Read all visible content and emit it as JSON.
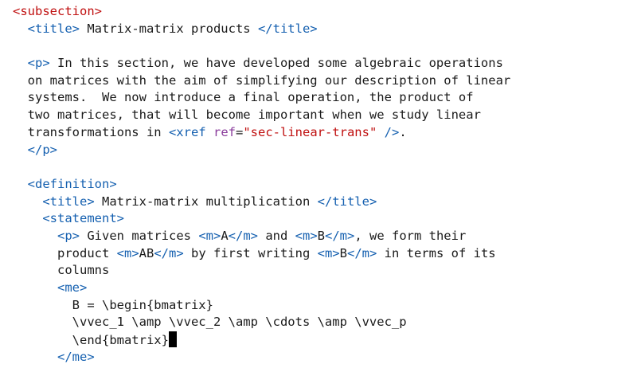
{
  "editor": {
    "lines": [
      [
        {
          "t": "<subsection>",
          "c": "tag-root"
        }
      ],
      [
        {
          "t": "  "
        },
        {
          "t": "<title>",
          "c": "tag"
        },
        {
          "t": " Matrix-matrix products "
        },
        {
          "t": "</title>",
          "c": "tag"
        }
      ],
      [],
      [
        {
          "t": "  "
        },
        {
          "t": "<p>",
          "c": "tag"
        },
        {
          "t": " In this section, we have developed some algebraic operations"
        }
      ],
      [
        {
          "t": "  on matrices with the aim of simplifying our description of linear"
        }
      ],
      [
        {
          "t": "  systems.  We now introduce a final operation, the product of"
        }
      ],
      [
        {
          "t": "  two matrices, that will become important when we study linear"
        }
      ],
      [
        {
          "t": "  transformations in "
        },
        {
          "t": "<xref",
          "c": "tag"
        },
        {
          "t": " "
        },
        {
          "t": "ref",
          "c": "attr"
        },
        {
          "t": "="
        },
        {
          "t": "\"sec-linear-trans\"",
          "c": "str"
        },
        {
          "t": " "
        },
        {
          "t": "/>",
          "c": "tag"
        },
        {
          "t": "."
        }
      ],
      [
        {
          "t": "  "
        },
        {
          "t": "</p>",
          "c": "tag"
        }
      ],
      [],
      [
        {
          "t": "  "
        },
        {
          "t": "<definition>",
          "c": "tag"
        }
      ],
      [
        {
          "t": "    "
        },
        {
          "t": "<title>",
          "c": "tag"
        },
        {
          "t": " Matrix-matrix multiplication "
        },
        {
          "t": "</title>",
          "c": "tag"
        }
      ],
      [
        {
          "t": "    "
        },
        {
          "t": "<statement>",
          "c": "tag"
        }
      ],
      [
        {
          "t": "      "
        },
        {
          "t": "<p>",
          "c": "tag"
        },
        {
          "t": " Given matrices "
        },
        {
          "t": "<m>",
          "c": "tag"
        },
        {
          "t": "A"
        },
        {
          "t": "</m>",
          "c": "tag"
        },
        {
          "t": " and "
        },
        {
          "t": "<m>",
          "c": "tag"
        },
        {
          "t": "B"
        },
        {
          "t": "</m>",
          "c": "tag"
        },
        {
          "t": ", we form their"
        }
      ],
      [
        {
          "t": "      product "
        },
        {
          "t": "<m>",
          "c": "tag"
        },
        {
          "t": "AB"
        },
        {
          "t": "</m>",
          "c": "tag"
        },
        {
          "t": " by first writing "
        },
        {
          "t": "<m>",
          "c": "tag"
        },
        {
          "t": "B"
        },
        {
          "t": "</m>",
          "c": "tag"
        },
        {
          "t": " in terms of its"
        }
      ],
      [
        {
          "t": "      columns"
        }
      ],
      [
        {
          "t": "      "
        },
        {
          "t": "<me>",
          "c": "tag"
        }
      ],
      [
        {
          "t": "        B = \\begin{bmatrix}"
        }
      ],
      [
        {
          "t": "        \\vvec_1 \\amp \\vvec_2 \\amp \\cdots \\amp \\vvec_p"
        }
      ],
      [
        {
          "t": "        \\end{bmatrix}"
        },
        {
          "cursor": true
        }
      ],
      [
        {
          "t": "      "
        },
        {
          "t": "</me>",
          "c": "tag"
        }
      ]
    ]
  }
}
